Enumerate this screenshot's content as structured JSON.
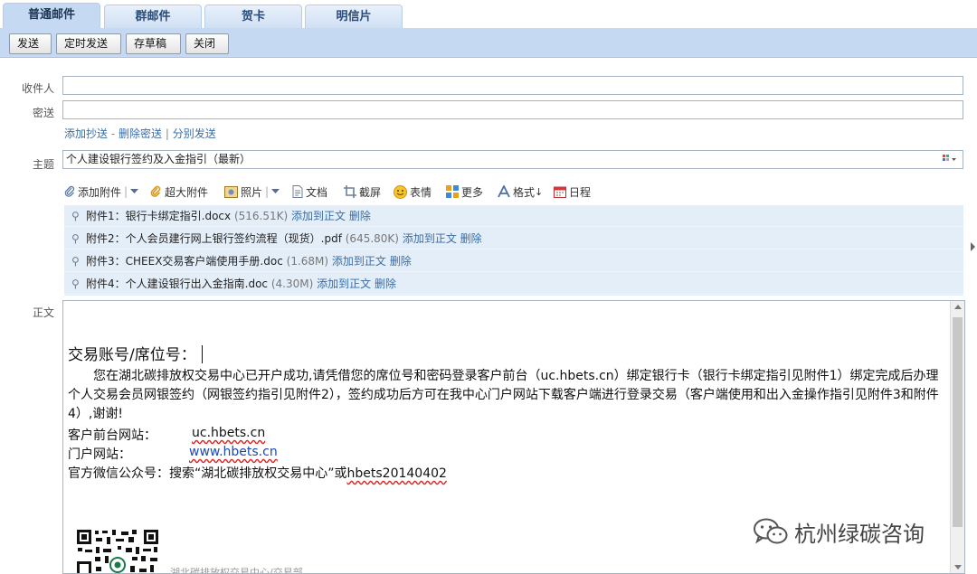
{
  "tabs": [
    "普通邮件",
    "群邮件",
    "贺卡",
    "明信片"
  ],
  "toolbar": {
    "send": "发送",
    "schedule": "定时发送",
    "draft": "存草稿",
    "close": "关闭"
  },
  "form": {
    "to_label": "收件人",
    "bcc_label": "密送",
    "links": {
      "add_cc": "添加抄送",
      "dash": "-",
      "remove_bcc": "删除密送",
      "sep": "|",
      "separate": "分别发送"
    },
    "subject_label": "主题",
    "subject_value": "个人建设银行签约及入金指引（最新）"
  },
  "attach_toolbar": {
    "add_attachment": "添加附件",
    "large_attachment": "超大附件",
    "photo": "照片",
    "document": "文档",
    "screenshot": "截屏",
    "emoji": "表情",
    "more": "更多",
    "format": "格式",
    "schedule": "日程"
  },
  "attachments": [
    {
      "label": "附件1：",
      "name": "银行卡绑定指引.docx",
      "size": "(516.51K)",
      "add": "添加到正文",
      "del": "删除"
    },
    {
      "label": "附件2：",
      "name": "个人会员建行网上银行签约流程（现货）.pdf",
      "size": "(645.80K)",
      "add": "添加到正文",
      "del": "删除"
    },
    {
      "label": "附件3：",
      "name": "CHEEX交易客户端使用手册.doc",
      "size": "(1.68M)",
      "add": "添加到正文",
      "del": "删除"
    },
    {
      "label": "附件4：",
      "name": "个人建设银行出入金指南.doc",
      "size": "(4.30M)",
      "add": "添加到正文",
      "del": "删除"
    }
  ],
  "body_label": "正文",
  "editor": {
    "title": "交易账号/席位号：",
    "paragraph": "您在湖北碳排放权交易中心已开户成功,请凭借您的席位号和密码登录客户前台（uc.hbets.cn）绑定银行卡（银行卡绑定指引见附件1）绑定完成后办理个人交易会员网银签约（网银签约指引见附件2），签约成功后方可在我中心门户网站下载客户端进行登录交易（客户端使用和出入金操作指引见附件3和附件4）,谢谢!",
    "client_label": "客户前台网站：",
    "client_url": "uc.hbets.cn",
    "portal_label": "门户网站：",
    "portal_url": "www.hbets.cn",
    "wechat_prefix": "官方微信公众号：搜索“湖北碳排放权交易中心”或",
    "wechat_id": "hbets20140402",
    "footer_partial": "湖北碳排放权交易中心/交易部"
  },
  "watermark": "杭州绿碳咨询"
}
